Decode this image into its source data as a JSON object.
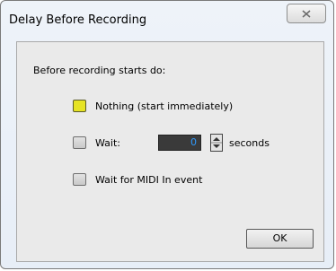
{
  "window": {
    "title": "Delay Before Recording",
    "close_icon": "close-icon"
  },
  "group": {
    "heading": "Before recording starts do:"
  },
  "options": [
    {
      "label": "Nothing (start immediately)",
      "checked": true
    },
    {
      "label": "Wait:",
      "checked": false
    },
    {
      "label": "Wait for MIDI In event",
      "checked": false
    }
  ],
  "wait": {
    "value": "0",
    "unit": "seconds"
  },
  "buttons": {
    "ok": "OK"
  },
  "colors": {
    "checked_fill": "#e6e323",
    "number_text": "#2f9bff"
  }
}
